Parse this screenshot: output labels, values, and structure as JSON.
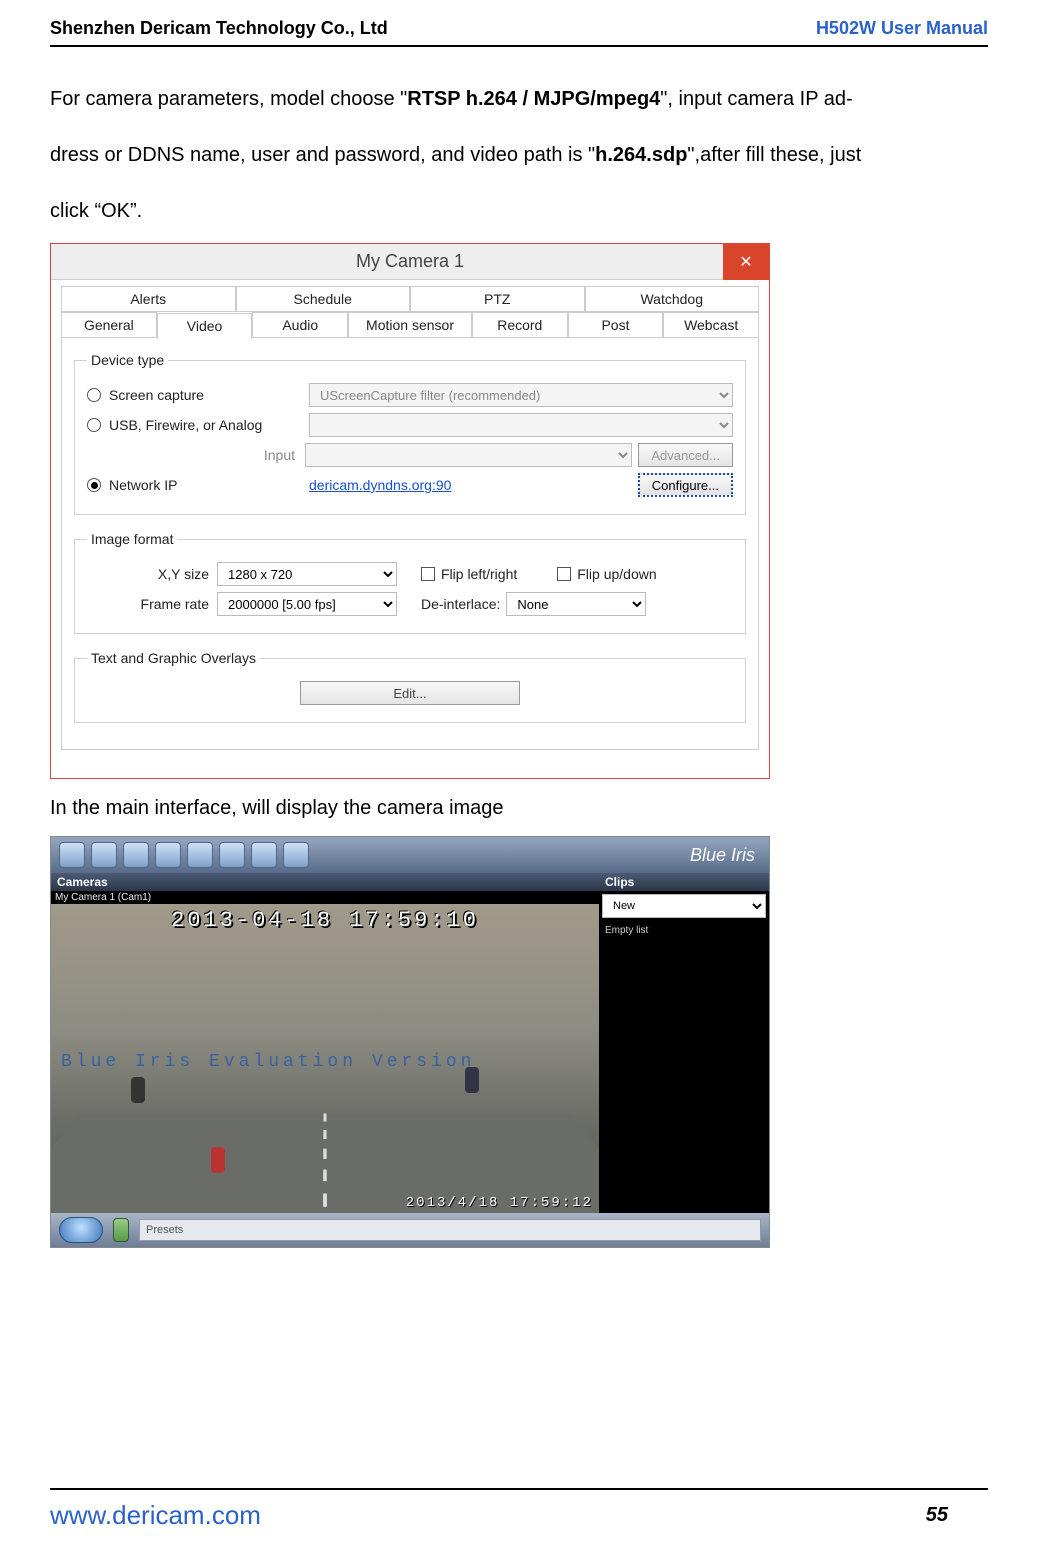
{
  "header": {
    "company": "Shenzhen Dericam Technology Co., Ltd",
    "manual": "H502W User Manual"
  },
  "para1_a": "For camera parameters, model choose \"",
  "para1_b": "RTSP h.264 / MJPG/mpeg4",
  "para1_c": "\", input camera IP ad-",
  "para2_a": "dress or DDNS name, user and password, and video path is \"",
  "para2_b": "h.264.sdp",
  "para2_c": "\",after fill these, just",
  "para3": "click “OK”.",
  "dialog": {
    "title": "My Camera 1",
    "tabs_row1": [
      "Alerts",
      "Schedule",
      "PTZ",
      "Watchdog"
    ],
    "tabs_row2": [
      "General",
      "Video",
      "Audio",
      "Motion sensor",
      "Record",
      "Post",
      "Webcast"
    ],
    "device_type_legend": "Device type",
    "radio1": "Screen capture",
    "radio2": "USB, Firewire, or Analog",
    "radio3": "Network IP",
    "screen_filter": "UScreenCapture filter (recommended)",
    "input_label": "Input",
    "advanced": "Advanced...",
    "network_link": "dericam.dyndns.org:90",
    "configure": "Configure...",
    "image_format_legend": "Image format",
    "xy_label": "X,Y size",
    "xy_val": "1280 x 720",
    "flip_lr": "Flip left/right",
    "flip_ud": "Flip up/down",
    "fr_label": "Frame rate",
    "fr_val": "2000000 [5.00 fps]",
    "deint_label": "De-interlace:",
    "deint_val": "None",
    "overlay_legend": "Text and Graphic Overlays",
    "edit": "Edit..."
  },
  "caption2": "In the main interface, will display the camera image",
  "bi": {
    "brand": "Blue Iris",
    "cameras": "Cameras",
    "cam_label": "My Camera 1 (Cam1)",
    "osd_top": "2013-04-18  17:59:10",
    "watermark": "Blue Iris Evaluation Version",
    "osd_bottom": "2013/4/18 17:59:12",
    "clips": "Clips",
    "clip_filter": "New",
    "empty": "Empty list",
    "presets": "Presets"
  },
  "footer": {
    "url": "www.dericam.com",
    "page": "55"
  }
}
